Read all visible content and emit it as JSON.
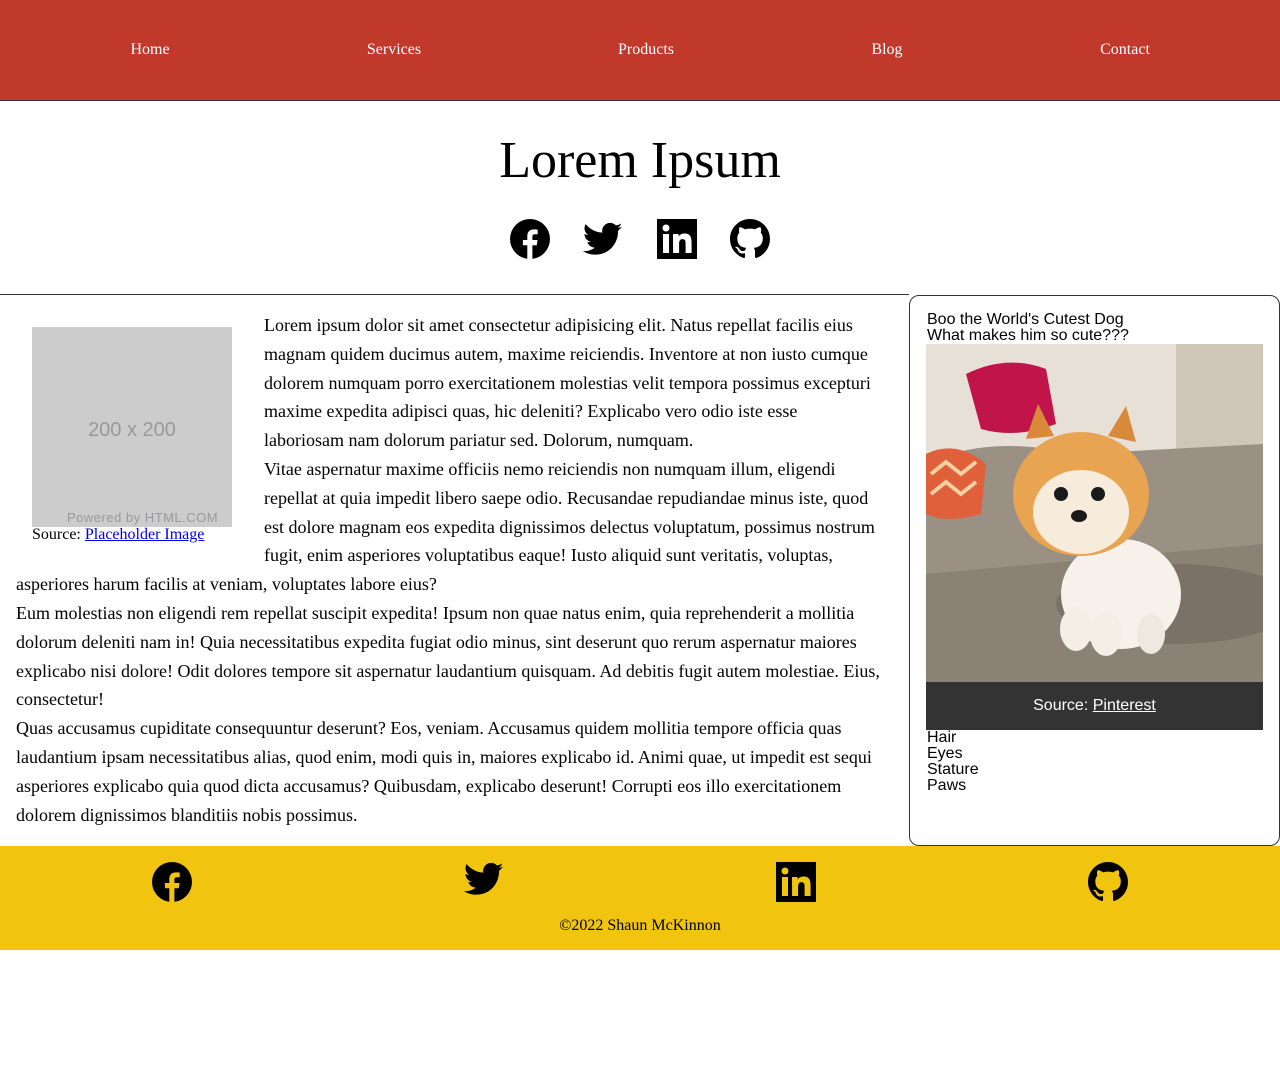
{
  "nav": {
    "items": [
      {
        "label": "Home"
      },
      {
        "label": "Services"
      },
      {
        "label": "Products"
      },
      {
        "label": "Blog"
      },
      {
        "label": "Contact"
      }
    ]
  },
  "header": {
    "title": "Lorem Ipsum",
    "social_icons": [
      "facebook-icon",
      "twitter-icon",
      "linkedin-icon",
      "github-icon"
    ]
  },
  "article": {
    "placeholder": {
      "dimensions": "200 x 200",
      "powered": "Powered by HTML.COM"
    },
    "caption": {
      "prefix": "Source: ",
      "link": "Placeholder Image"
    },
    "paragraphs": [
      "Lorem ipsum dolor sit amet consectetur adipisicing elit. Natus repellat facilis eius magnam quidem ducimus autem, maxime reiciendis. Inventore at non iusto cumque dolorem numquam porro exercitationem molestias velit tempora possimus excepturi maxime expedita adipisci quas, hic deleniti? Explicabo vero odio iste esse laboriosam nam dolorum pariatur sed. Dolorum, numquam.",
      "Vitae aspernatur maxime officiis nemo reiciendis non numquam illum, eligendi repellat at quia impedit libero saepe odio. Recusandae repudiandae minus iste, quod est dolore magnam eos expedita dignissimos delectus voluptatum, possimus nostrum fugit, enim asperiores voluptatibus eaque! Iusto aliquid sunt veritatis, voluptas, asperiores harum facilis at veniam, voluptates labore eius?",
      "Eum molestias non eligendi rem repellat suscipit expedita! Ipsum non quae natus enim, quia reprehenderit a mollitia dolorum deleniti nam in! Quia necessitatibus expedita fugiat odio minus, sint deserunt quo rerum aspernatur maiores explicabo nisi dolore! Odit dolores tempore sit aspernatur laudantium quisquam. Ad debitis fugit autem molestiae. Eius, consectetur!",
      "Quas accusamus cupiditate consequuntur deserunt? Eos, veniam. Accusamus quidem mollitia tempore officia quas laudantium ipsam necessitatibus alias, quod enim, modi quis in, maiores explicabo id. Animi quae, ut impedit est sequi asperiores explicabo quia quod dicta accusamus? Quibusdam, explicabo deserunt! Corrupti eos illo exercitationem dolorem dignissimos blanditiis nobis possimus."
    ]
  },
  "sidebar": {
    "title": "Boo the World's Cutest Dog",
    "subtitle": "What makes him so cute???",
    "image_caption": {
      "prefix": "Source: ",
      "link": "Pinterest"
    },
    "list": [
      "Hair",
      "Eyes",
      "Stature",
      "Paws"
    ]
  },
  "footer": {
    "social_icons": [
      "facebook-icon",
      "twitter-icon",
      "linkedin-icon",
      "github-icon"
    ],
    "copyright": "©2022 Shaun McKinnon"
  },
  "colors": {
    "nav_bg": "#c0392b",
    "footer_bg": "#f1c40f",
    "caption_bg": "#333333",
    "link": "#0000ee"
  }
}
